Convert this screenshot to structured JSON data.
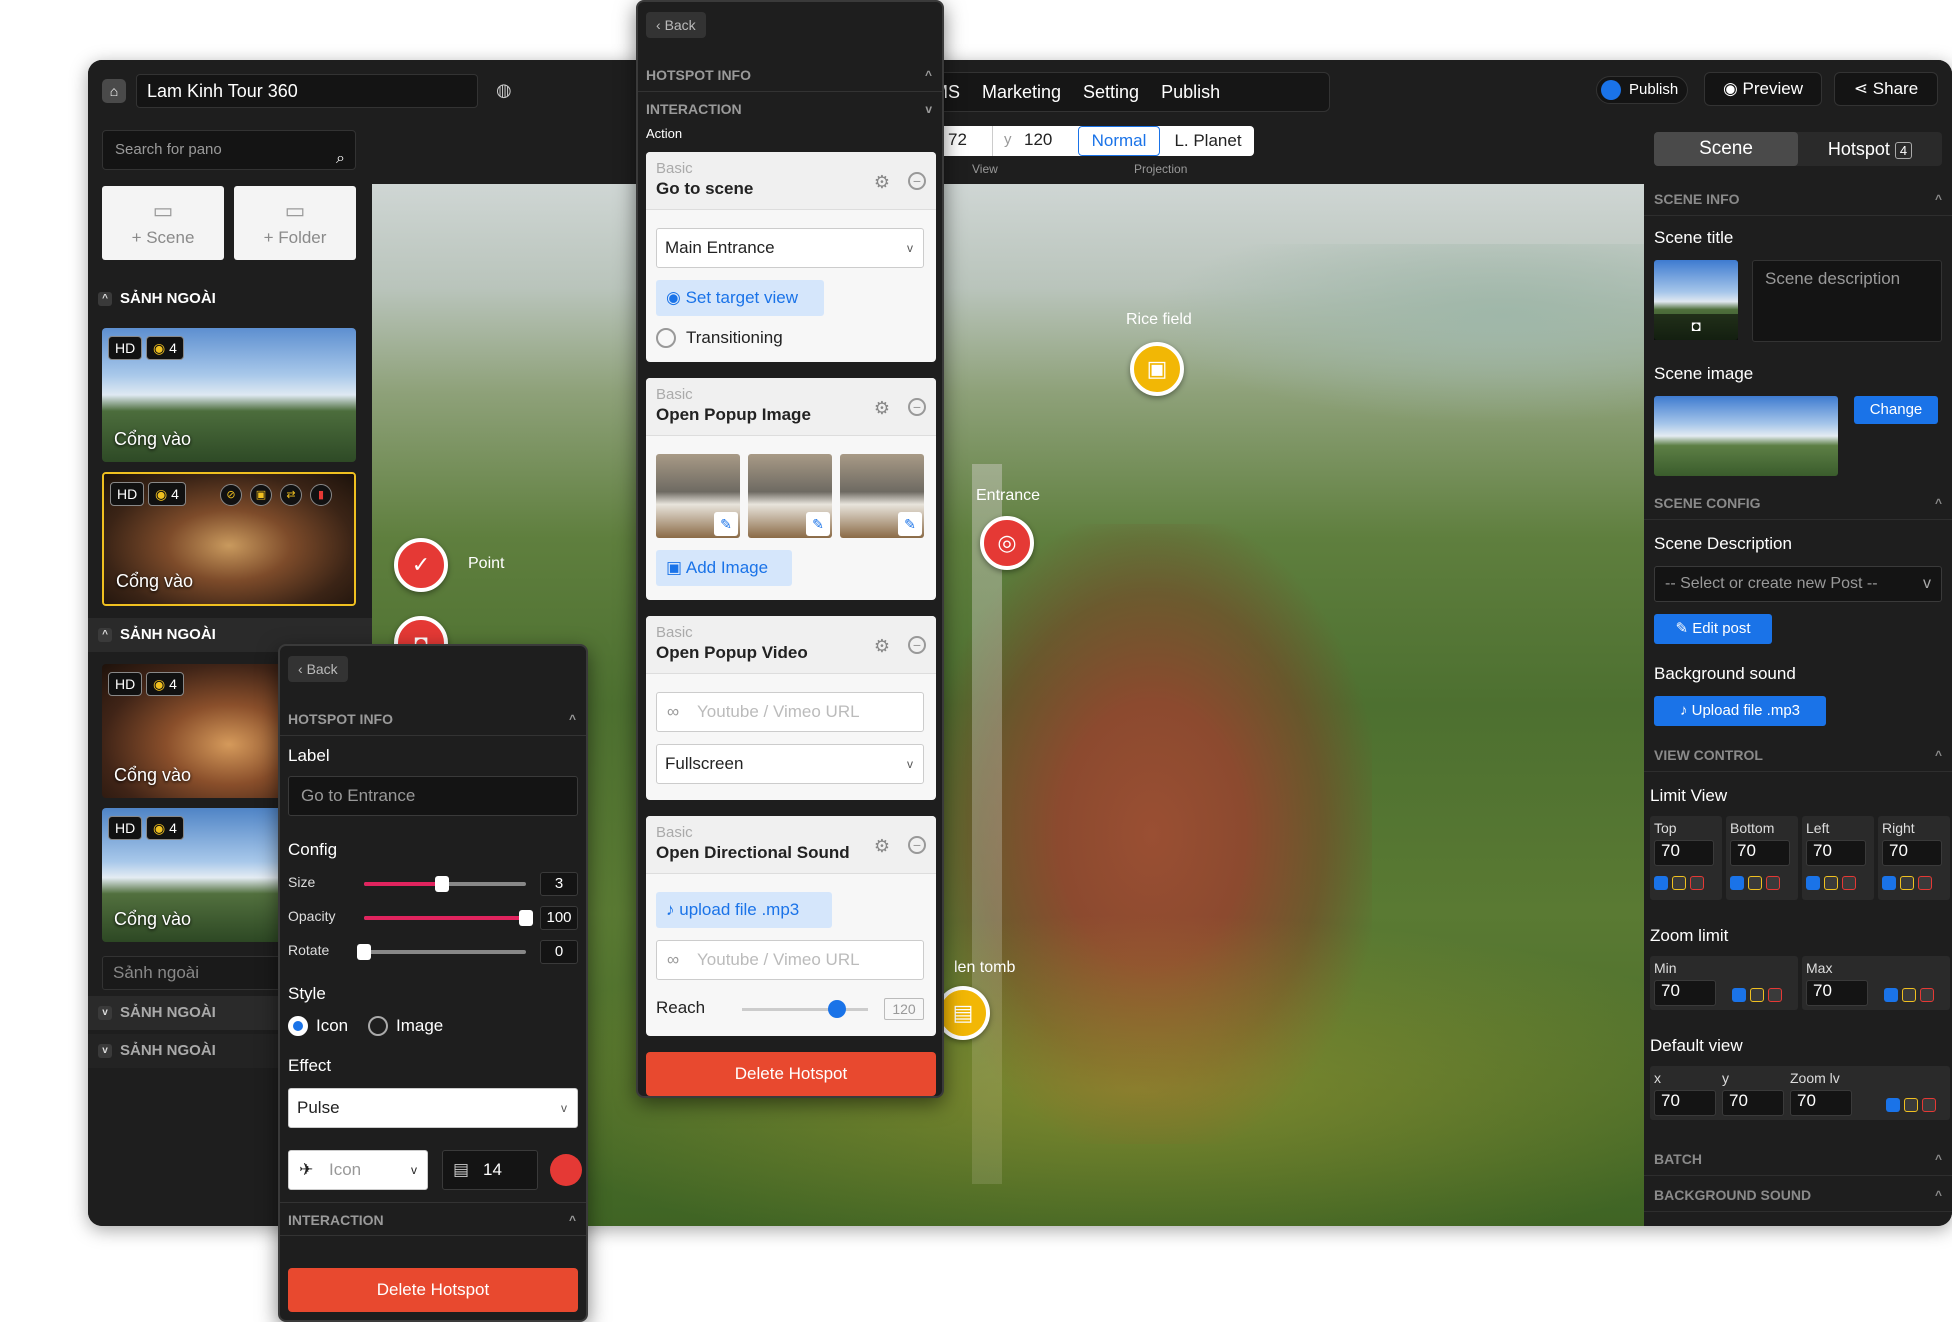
{
  "app": {
    "title": "Lam Kinh Tour 360",
    "menu": [
      "MS",
      "Marketing",
      "Setting",
      "Publish"
    ],
    "publish_toggle": "Publish",
    "preview": "Preview",
    "share": "Share"
  },
  "view_bar": {
    "x_value": "72",
    "y_label": "y",
    "y_value": "120",
    "view_label": "View",
    "proj_normal": "Normal",
    "proj_planet": "L. Planet",
    "projection_label": "Projection"
  },
  "sidebar": {
    "search_placeholder": "Search for pano",
    "add_scene": "+ Scene",
    "add_folder": "+ Folder",
    "group1": "SẢNH NGOÀI",
    "group2": "SẢNH NGOÀI",
    "group3": "SẢNH NGOÀI",
    "group4": "SẢNH NGOÀI",
    "rename_placeholder": "Sảnh ngoài",
    "cards": [
      {
        "hd": "HD",
        "count": "4",
        "name": "Cổng vào"
      },
      {
        "hd": "HD",
        "count": "4",
        "name": "Cổng vào"
      },
      {
        "hd": "HD",
        "count": "4",
        "name": "Cổng vào"
      },
      {
        "hd": "HD",
        "count": "4",
        "name": "Cổng vào"
      }
    ]
  },
  "markers": {
    "point": "Point",
    "rice_field": "Rice field",
    "entrance": "Entrance",
    "tomb": "len tomb"
  },
  "right_panel": {
    "tab_scene": "Scene",
    "tab_hotspot": "Hotspot",
    "hotspot_count": "4",
    "scene_info": "SCENE INFO",
    "scene_title": "Scene title",
    "scene_description_placeholder": "Scene description",
    "scene_image": "Scene image",
    "change": "Change",
    "scene_config": "SCENE CONFIG",
    "scene_description": "Scene Description",
    "select_post": "-- Select or create new Post --",
    "edit_post": "Edit post",
    "background_sound": "Background sound",
    "upload_mp3": "Upload file .mp3",
    "view_control": "VIEW CONTROL",
    "limit_view": "Limit View",
    "limits": [
      {
        "label": "Top",
        "value": "70"
      },
      {
        "label": "Bottom",
        "value": "70"
      },
      {
        "label": "Left",
        "value": "70"
      },
      {
        "label": "Right",
        "value": "70"
      }
    ],
    "zoom_limit": "Zoom limit",
    "zoom_min_label": "Min",
    "zoom_min": "70",
    "zoom_max_label": "Max",
    "zoom_max": "70",
    "default_view": "Default view",
    "dv_x_label": "x",
    "dv_x": "70",
    "dv_y_label": "y",
    "dv_y": "70",
    "dv_zoom_label": "Zoom lv",
    "dv_zoom": "70",
    "batch": "BATCH",
    "background_sound_section": "BACKGROUND SOUND"
  },
  "hotspot_panel_a": {
    "back": "Back",
    "hotspot_info": "HOTSPOT INFO",
    "interaction": "INTERACTION",
    "action": "Action",
    "card1": {
      "basic": "Basic",
      "title": "Go to scene",
      "select": "Main Entrance",
      "set_target": "Set target view",
      "transitioning": "Transitioning"
    },
    "card2": {
      "basic": "Basic",
      "title": "Open Popup Image",
      "add_image": "Add Image"
    },
    "card3": {
      "basic": "Basic",
      "title": "Open Popup Video",
      "url_placeholder": "Youtube / Vimeo URL",
      "mode": "Fullscreen"
    },
    "card4": {
      "basic": "Basic",
      "title": "Open Directional Sound",
      "upload": "upload file .mp3",
      "url_placeholder": "Youtube / Vimeo URL",
      "reach": "Reach",
      "reach_value": "120",
      "reach_fraction": 0.75
    },
    "delete": "Delete Hotspot"
  },
  "hotspot_panel_b": {
    "back": "Back",
    "hotspot_info": "HOTSPOT INFO",
    "label": "Label",
    "label_placeholder": "Go to Entrance",
    "config": "Config",
    "size_label": "Size",
    "size_value": "3",
    "size_fraction": 0.48,
    "opacity_label": "Opacity",
    "opacity_value": "100",
    "opacity_fraction": 1.0,
    "rotate_label": "Rotate",
    "rotate_value": "0",
    "rotate_fraction": 0.0,
    "style": "Style",
    "style_icon": "Icon",
    "style_image": "Image",
    "effect": "Effect",
    "effect_value": "Pulse",
    "icon_select": "Icon",
    "icon_size": "14",
    "interaction": "INTERACTION",
    "delete": "Delete Hotspot"
  },
  "colors": {
    "accent": "#1a73e8",
    "danger": "#e8492f",
    "marker_red": "#e53935",
    "marker_yellow": "#f2b705",
    "slider": "#e0245e"
  }
}
